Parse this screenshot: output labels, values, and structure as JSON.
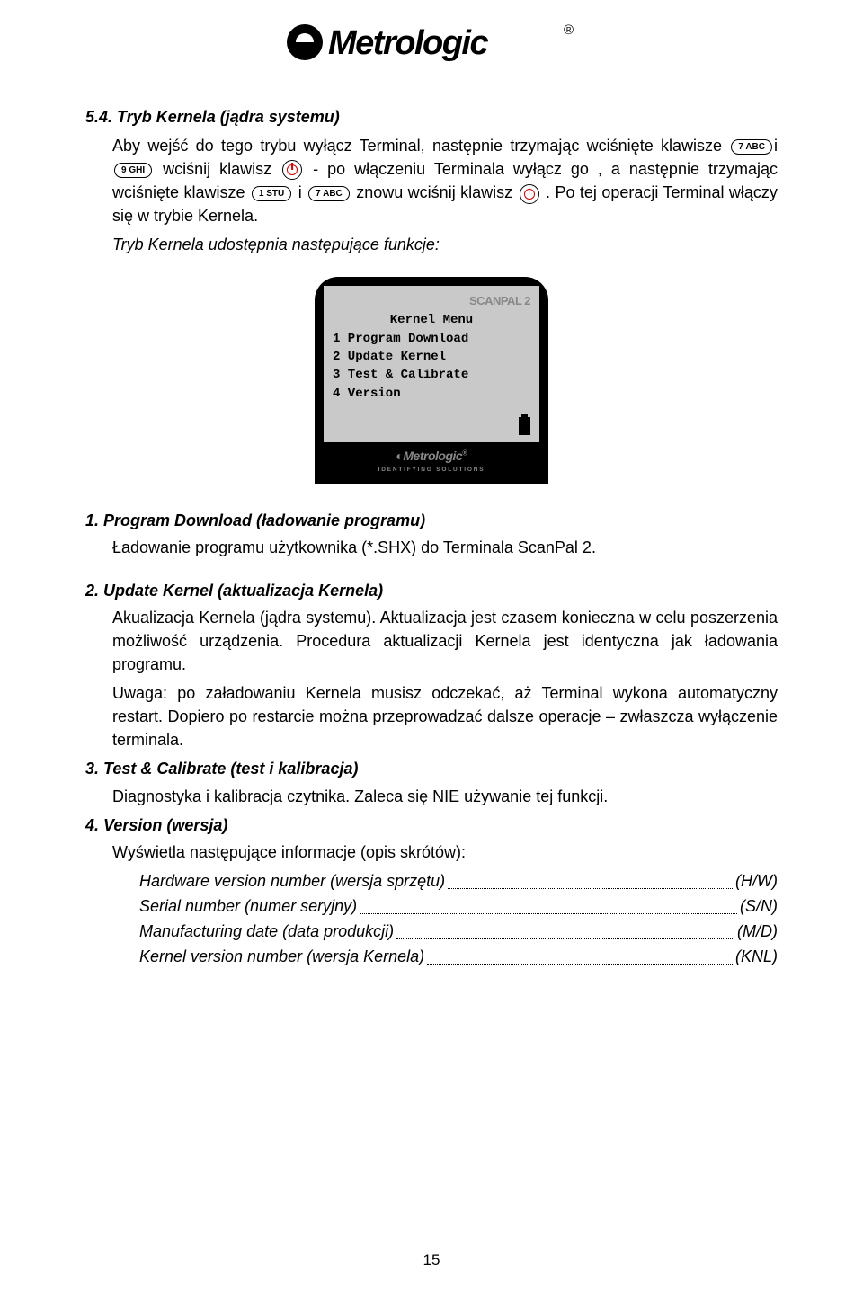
{
  "logo": {
    "brand": "Metrologic",
    "registered": "®"
  },
  "section": {
    "number_title": "5.4.  Tryb Kernela (jądra systemu)"
  },
  "intro": {
    "p1a": "Aby wejść do tego trybu wyłącz Terminal, następnie trzymając wciśnięte klawisze",
    "p1b": "i",
    "p2a": "wciśnij klawisz",
    "p2b": "- po włączeniu Terminala wyłącz go , a następnie trzymając wciśnięte klawisze",
    "p2c": "i",
    "p2d": "znowu wciśnij klawisz",
    "p2e": ". Po tej operacji Terminal włączy się w trybie Kernela.",
    "p3": "Tryb Kernela  udostępnia następujące funkcje:"
  },
  "keys": {
    "k7abc": "7 ABC",
    "k9ghi": "9 GHI",
    "k1stu": "1 STU"
  },
  "screen": {
    "brand": "SCANPAL 2",
    "title": "Kernel Menu",
    "lines": [
      "1 Program Download",
      "2 Update Kernel",
      "3 Test & Calibrate",
      "4 Version"
    ],
    "device_brand": "Metrologic",
    "device_sub": "IDENTIFYING SOLUTIONS"
  },
  "items": [
    {
      "num": "1.",
      "title": "Program Download (ładowanie programu)",
      "body": [
        "Ładowanie programu użytkownika (*.SHX) do Terminala ScanPal 2."
      ],
      "shx_italic": true
    },
    {
      "num": "2.",
      "title": "Update Kernel (aktualizacja Kernela)",
      "body": [
        "Akualizacja Kernela (jądra systemu). Aktualizacja jest czasem konieczna w celu poszerzenia możliwość urządzenia. Procedura aktualizacji Kernela jest identyczna jak ładowania programu.",
        "Uwaga: po załadowaniu Kernela musisz odczekać, aż Terminal wykona automatyczny restart. Dopiero po restarcie można przeprowadzać dalsze operacje – zwłaszcza wyłączenie terminala."
      ]
    },
    {
      "num": "3.",
      "title": "Test & Calibrate (test i kalibracja)",
      "body": [
        "Diagnostyka i kalibracja czytnika. Zaleca się NIE używanie tej funkcji."
      ]
    },
    {
      "num": "4.",
      "title": "Version (wersja)",
      "body": [
        "Wyświetla następujące informacje (opis skrótów):"
      ],
      "info": [
        {
          "label": "Hardware version number (wersja sprzętu)",
          "code": "(H/W)"
        },
        {
          "label": "Serial number (numer seryjny)",
          "code": "(S/N)"
        },
        {
          "label": "Manufacturing date (data produkcji)",
          "code": "(M/D)"
        },
        {
          "label": "Kernel version number (wersja Kernela)",
          "code": "(KNL)"
        }
      ]
    }
  ],
  "page_number": "15"
}
